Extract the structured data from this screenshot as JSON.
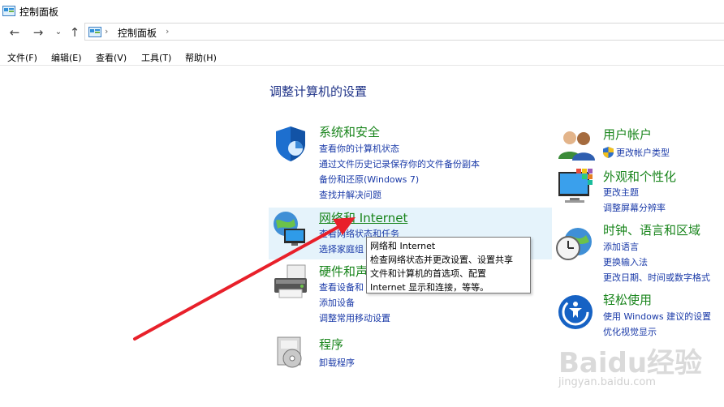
{
  "window": {
    "title": "控制面板"
  },
  "address": {
    "crumb": "控制面板",
    "separator": "›"
  },
  "menu": [
    "文件(F)",
    "编辑(E)",
    "查看(V)",
    "工具(T)",
    "帮助(H)"
  ],
  "heading": "调整计算机的设置",
  "categories": {
    "system": {
      "title": "系统和安全",
      "links": [
        "查看你的计算机状态",
        "通过文件历史记录保存你的文件备份副本",
        "备份和还原(Windows 7)",
        "查找并解决问题"
      ]
    },
    "network": {
      "title": "网络和 Internet",
      "links": [
        "查看网络状态和任务",
        "选择家庭组"
      ]
    },
    "hardware": {
      "title": "硬件和声",
      "links": [
        "查看设备和",
        "添加设备",
        "调整常用移动设置"
      ]
    },
    "programs": {
      "title": "程序",
      "links": [
        "卸载程序"
      ]
    },
    "users": {
      "title": "用户帐户",
      "links": [
        "更改帐户类型"
      ]
    },
    "appearance": {
      "title": "外观和个性化",
      "links": [
        "更改主题",
        "调整屏幕分辨率"
      ]
    },
    "clock": {
      "title": "时钟、语言和区域",
      "links": [
        "添加语言",
        "更换输入法",
        "更改日期、时间或数字格式"
      ]
    },
    "ease": {
      "title": "轻松使用",
      "links": [
        "使用 Windows 建议的设置",
        "优化视觉显示"
      ]
    }
  },
  "tooltip": {
    "lines": [
      "网络和 Internet",
      "检查网络状态并更改设置、设置共享",
      "文件和计算机的首选项、配置",
      "Internet 显示和连接，等等。"
    ]
  },
  "watermark": {
    "main": "Baidu经验",
    "sub": "jingyan.baidu.com"
  },
  "colors": {
    "category_title": "#19851c",
    "link": "#1a3aa8",
    "heading": "#1e3287",
    "annotation_arrow": "#e8202a"
  }
}
